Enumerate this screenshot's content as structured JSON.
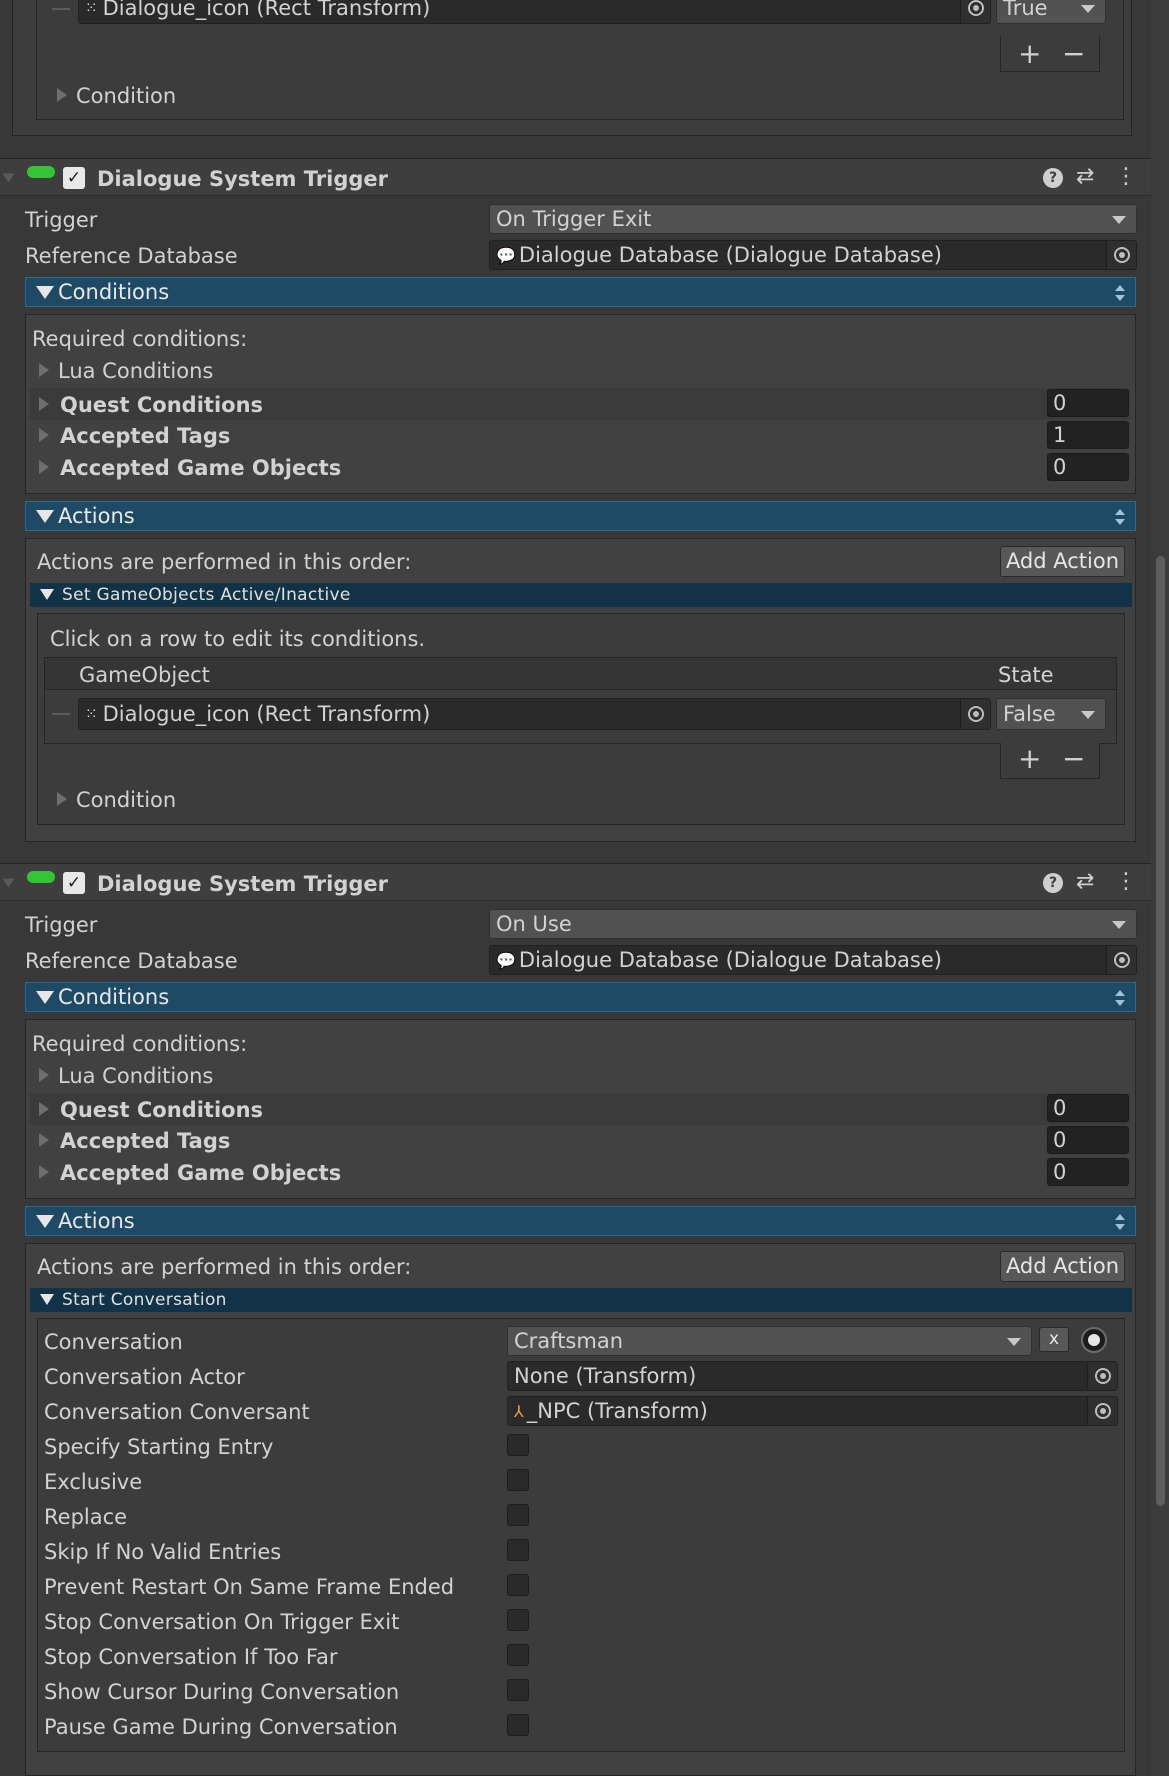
{
  "top_partial": {
    "row_object": "Dialogue_icon (Rect Transform)",
    "row_state": "True",
    "plus_label": "+",
    "minus_label": "−",
    "condition_label": "Condition"
  },
  "trigger1": {
    "title": "Dialogue System Trigger",
    "trigger_label": "Trigger",
    "trigger_value": "On Trigger Exit",
    "refdb_label": "Reference Database",
    "refdb_value": "Dialogue Database (Dialogue Database)",
    "conditions_label": "Conditions",
    "required_label": "Required conditions:",
    "lua_label": "Lua Conditions",
    "quest_label": "Quest Conditions",
    "quest_value": "0",
    "tags_label": "Accepted Tags",
    "tags_value": "1",
    "objects_label": "Accepted Game Objects",
    "objects_value": "0",
    "actions_label": "Actions",
    "actions_order_label": "Actions are performed in this order:",
    "add_action_label": "Add Action",
    "action_title": "Set GameObjects Active/Inactive",
    "hint": "Click on a row to edit its conditions.",
    "col_gameobject": "GameObject",
    "col_state": "State",
    "row_object": "Dialogue_icon (Rect Transform)",
    "row_state": "False",
    "plus_label": "+",
    "minus_label": "−",
    "condition_label": "Condition"
  },
  "trigger2": {
    "title": "Dialogue System Trigger",
    "trigger_label": "Trigger",
    "trigger_value": "On Use",
    "refdb_label": "Reference Database",
    "refdb_value": "Dialogue Database (Dialogue Database)",
    "conditions_label": "Conditions",
    "required_label": "Required conditions:",
    "lua_label": "Lua Conditions",
    "quest_label": "Quest Conditions",
    "quest_value": "0",
    "tags_label": "Accepted Tags",
    "tags_value": "0",
    "objects_label": "Accepted Game Objects",
    "objects_value": "0",
    "actions_label": "Actions",
    "actions_order_label": "Actions are performed in this order:",
    "add_action_label": "Add Action",
    "action_title": "Start Conversation",
    "conversation_label": "Conversation",
    "conversation_value": "Craftsman",
    "clear_label": "x",
    "actor_label": "Conversation Actor",
    "actor_value": "None (Transform)",
    "conversant_label": "Conversation Conversant",
    "conversant_value": "_NPC (Transform)",
    "checkboxes": [
      "Specify Starting Entry",
      "Exclusive",
      "Replace",
      "Skip If No Valid Entries",
      "Prevent Restart On Same Frame Ended",
      "Stop Conversation On Trigger Exit",
      "Stop Conversation If Too Far",
      "Show Cursor During Conversation",
      "Pause Game During Conversation"
    ]
  },
  "icons": {
    "help": "help-icon",
    "presets": "presets-icon",
    "more": "kebab-menu-icon",
    "picker": "object-picker-icon",
    "rect_transform": "rect-transform-icon",
    "transform": "transform-icon",
    "database": "database-bubble-icon"
  },
  "colors": {
    "background": "#383838",
    "section_bar": "#1f4a66",
    "sub_bar": "#123347",
    "enabled_pill": "#34c534"
  }
}
